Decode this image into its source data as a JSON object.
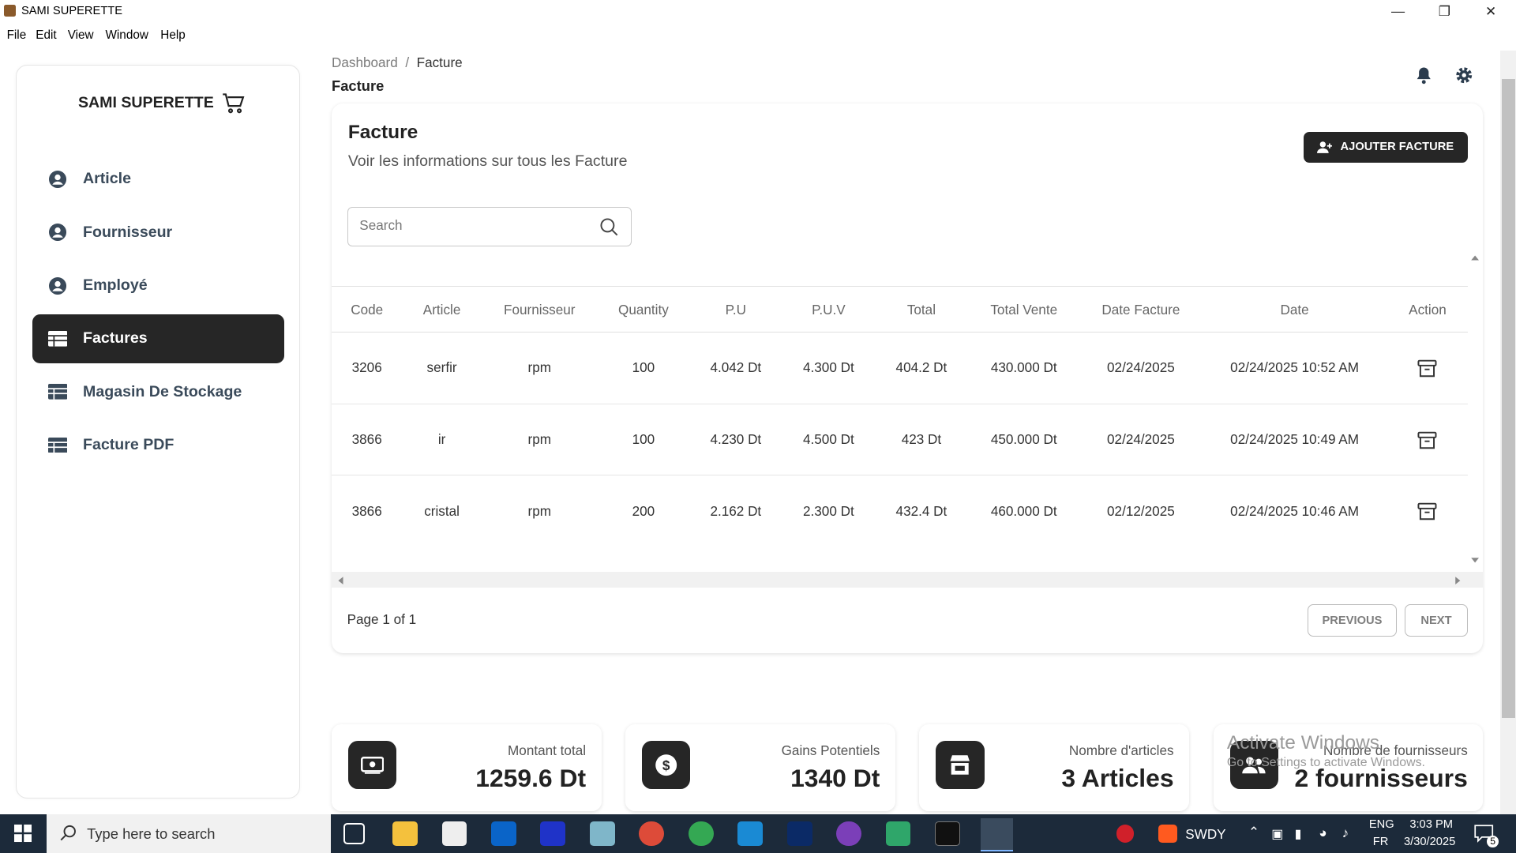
{
  "window": {
    "title": "SAMI SUPERETTE"
  },
  "menu": [
    "File",
    "Edit",
    "View",
    "Window",
    "Help"
  ],
  "sidebar": {
    "brand": "SAMI SUPERETTE",
    "items": [
      {
        "label": "Article",
        "icon": "user-circle-icon",
        "active": false
      },
      {
        "label": "Fournisseur",
        "icon": "user-circle-icon",
        "active": false
      },
      {
        "label": "Employé",
        "icon": "user-circle-icon",
        "active": false
      },
      {
        "label": "Factures",
        "icon": "table-icon",
        "active": true
      },
      {
        "label": "Magasin De Stockage",
        "icon": "table-icon",
        "active": false
      },
      {
        "label": "Facture PDF",
        "icon": "table-icon",
        "active": false
      }
    ]
  },
  "breadcrumb": {
    "root": "Dashboard",
    "sep": "/",
    "current": "Facture"
  },
  "page_title": "Facture",
  "card": {
    "title": "Facture",
    "subtitle": "Voir les informations sur tous les Facture",
    "add_button": "AJOUTER FACTURE",
    "search_placeholder": "Search"
  },
  "table": {
    "headers": [
      "Code",
      "Article",
      "Fournisseur",
      "Quantity",
      "P.U",
      "P.U.V",
      "Total",
      "Total Vente",
      "Date Facture",
      "Date",
      "Action"
    ],
    "rows": [
      [
        "3206",
        "serfir",
        "rpm",
        "100",
        "4.042 Dt",
        "4.300 Dt",
        "404.2 Dt",
        "430.000 Dt",
        "02/24/2025",
        "02/24/2025 10:52 AM"
      ],
      [
        "3866",
        "ir",
        "rpm",
        "100",
        "4.230 Dt",
        "4.500 Dt",
        "423 Dt",
        "450.000 Dt",
        "02/24/2025",
        "02/24/2025 10:49 AM"
      ],
      [
        "3866",
        "cristal",
        "rpm",
        "200",
        "2.162 Dt",
        "2.300 Dt",
        "432.4 Dt",
        "460.000 Dt",
        "02/12/2025",
        "02/24/2025 10:46 AM"
      ]
    ]
  },
  "pagination": {
    "info": "Page 1 of 1",
    "previous": "PREVIOUS",
    "next": "NEXT"
  },
  "stats": [
    {
      "label": "Montant total",
      "value": "1259.6 Dt",
      "icon": "money-icon"
    },
    {
      "label": "Gains Potentiels",
      "value": "1340 Dt",
      "icon": "dollar-icon"
    },
    {
      "label": "Nombre d'articles",
      "value": "3 Articles",
      "icon": "store-icon"
    },
    {
      "label": "Nombre de fournisseurs",
      "value": "2 fournisseurs",
      "icon": "users-icon"
    }
  ],
  "watermark": {
    "title": "Activate Windows",
    "sub": "Go to Settings to activate Windows."
  },
  "taskbar": {
    "search_placeholder": "Type here to search",
    "swdy": "SWDY",
    "lang1": "ENG",
    "lang2": "FR",
    "time": "3:03 PM",
    "date": "3/30/2025",
    "notif": "5"
  }
}
